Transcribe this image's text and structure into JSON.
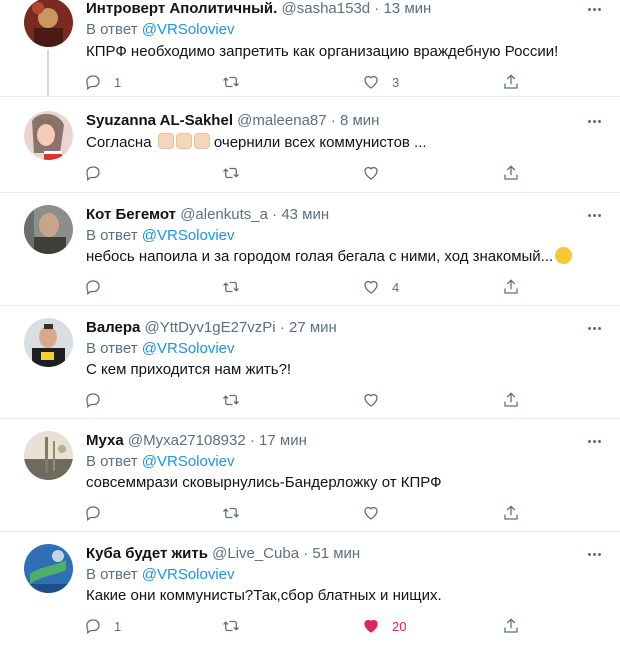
{
  "reply_prefix": "В ответ",
  "tweets": [
    {
      "name": "Интроверт Аполитичный.",
      "handle": "@sasha153d",
      "time": "13 мин",
      "reply_to": "@VRSoloviev",
      "text": "КПРФ необходимо запретить как организацию враждебную России!",
      "replies": "1",
      "retweets": "",
      "likes": "3",
      "liked": false
    },
    {
      "name": "Syuzanna AL-Sakhel",
      "handle": "@maleena87",
      "time": "8 мин",
      "reply_to": "",
      "text_before": "Согласна",
      "text": "очернили всех коммунистов ...",
      "replies": "",
      "retweets": "",
      "likes": "",
      "liked": false
    },
    {
      "name": "Кот Бегемот",
      "handle": "@alenkuts_a",
      "time": "43 мин",
      "reply_to": "@VRSoloviev",
      "text": "небось напоила и за городом голая бегала  с ними, ход знакомый...",
      "replies": "",
      "retweets": "",
      "likes": "4",
      "liked": false
    },
    {
      "name": "Валера",
      "handle": "@YttDyv1gE27vzPi",
      "time": "27 мин",
      "reply_to": "@VRSoloviev",
      "text": "С кем приходится нам жить?!",
      "replies": "",
      "retweets": "",
      "likes": "",
      "liked": false
    },
    {
      "name": "Муха",
      "handle": "@Myxa27108932",
      "time": "17 мин",
      "reply_to": "@VRSoloviev",
      "text": "совсеммрази сковырнулись-Бандерложку от КПРФ",
      "replies": "",
      "retweets": "",
      "likes": "",
      "liked": false
    },
    {
      "name": "Куба будет жить",
      "handle": "@Live_Cuba",
      "time": "51 мин",
      "reply_to": "@VRSoloviev",
      "text": "Какие они коммунисты?Так,сбор блатных и нищих.",
      "replies": "1",
      "retweets": "",
      "likes": "20",
      "liked": true
    }
  ],
  "colors": {
    "secondary_text": "#5b7083",
    "mention": "#1b95e0",
    "like_active": "#e0245e",
    "divider": "#ebeef0"
  },
  "icons": [
    "reply-icon",
    "retweet-icon",
    "like-icon",
    "share-icon",
    "more-icon"
  ]
}
